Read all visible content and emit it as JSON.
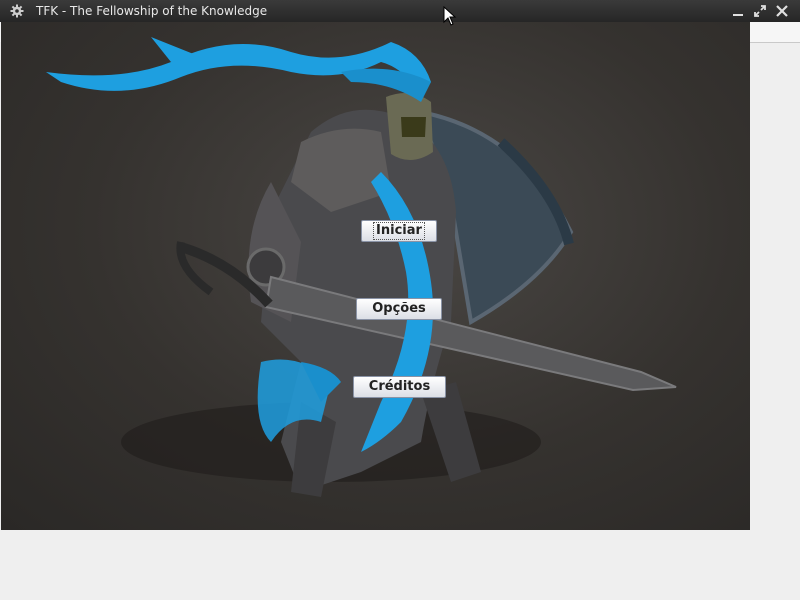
{
  "window": {
    "title": "TFK - The Fellowship of the Knowledge",
    "app_icon": "gear-icon",
    "controls": [
      "minimize-icon",
      "maximize-icon",
      "close-icon"
    ]
  },
  "menu": {
    "start_label": "Iniciar",
    "options_label": "Opções",
    "credits_label": "Créditos"
  },
  "background": {
    "description_icon": "knight-artwork",
    "accent_color": "#1e9fe0",
    "backdrop_color": "#35322f"
  }
}
